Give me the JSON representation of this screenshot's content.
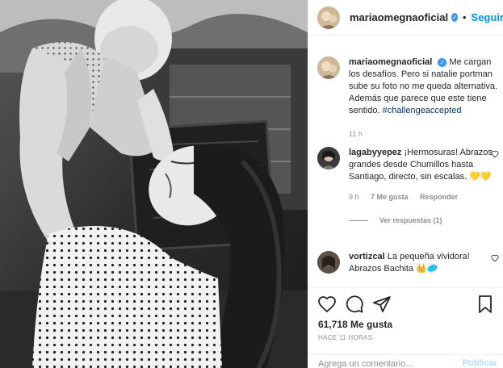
{
  "post": {
    "photo_alt": "Woman holding baby up",
    "author": "mariaomegnaoficial",
    "verified_glyph": "✓",
    "follow_label": "Seguir",
    "dot": "•",
    "caption": "Me cargan los desafíos. Pero si natalie portman sube su foto no me queda alternativa. Además que parece que este tiene sentido.",
    "hashtag": "#challengeaccepted",
    "caption_time": "11 h"
  },
  "comments": [
    {
      "user": "lagabyyepez",
      "text": "¡Hermosuras! Abrazos grandes desde Chumillos hasta Santiago, directo, sin escalas. 💛💛",
      "time": "9 h",
      "likes": "7 Me gusta",
      "reply": "Responder",
      "view_replies": "Ver respuestas (1)"
    },
    {
      "user": "vortizcal",
      "text": "La pequeña vividora! Abrazos Bachita 👑🥏"
    }
  ],
  "actions": {
    "likes_count": "61,718 Me gusta",
    "posted_ago": "HACE 11 HORAS",
    "comment_placeholder": "Agrega un comentario...",
    "publish_label": "Publicar"
  },
  "icons": {
    "like": "heart-icon",
    "comment": "comment-icon",
    "share": "share-icon",
    "save": "bookmark-icon"
  },
  "colors": {
    "link_blue": "#0095f6",
    "verified_blue": "#3897f0",
    "hashtag": "#00376b",
    "muted": "#8e8e8e"
  }
}
